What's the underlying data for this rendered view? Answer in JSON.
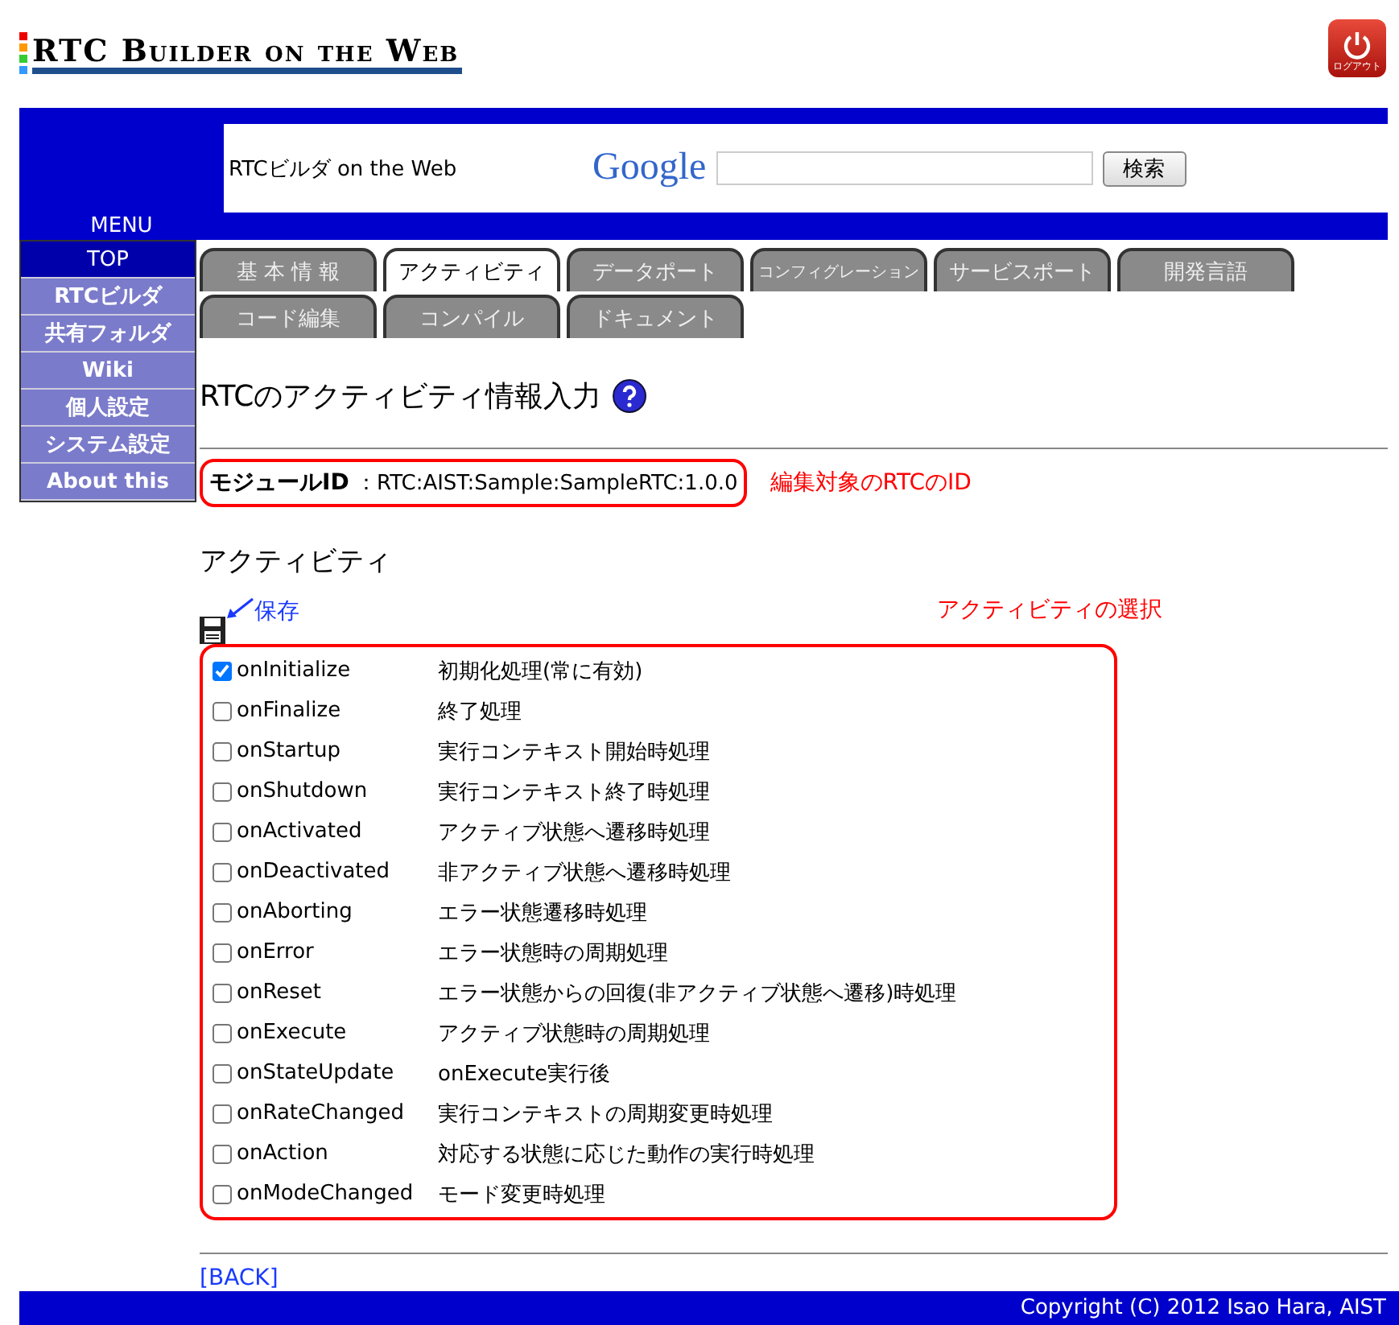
{
  "header": {
    "logo": "RTC Builder on the Web",
    "logout": "ログアウト"
  },
  "banner": {
    "site_name": "RTCビルダ on the Web",
    "search_logo": "Google",
    "search_button": "検索"
  },
  "menu": {
    "title": "MENU",
    "items": [
      {
        "label": "TOP",
        "selected": true
      },
      {
        "label": "RTCビルダ",
        "selected": false
      },
      {
        "label": "共有フォルダ",
        "selected": false
      },
      {
        "label": "Wiki",
        "selected": false
      },
      {
        "label": "個人設定",
        "selected": false
      },
      {
        "label": "システム設定",
        "selected": false
      },
      {
        "label": "About this",
        "selected": false
      }
    ]
  },
  "tabs": [
    [
      {
        "label": "基 本 情 報",
        "selected": false,
        "small": false
      },
      {
        "label": "アクティビティ",
        "selected": true,
        "small": false
      },
      {
        "label": "データポート",
        "selected": false,
        "small": false
      },
      {
        "label": "コンフィグレーション",
        "selected": false,
        "small": true
      },
      {
        "label": "サービスポート",
        "selected": false,
        "small": false
      },
      {
        "label": "開発言語",
        "selected": false,
        "small": false
      }
    ],
    [
      {
        "label": "コード編集",
        "selected": false,
        "small": false
      },
      {
        "label": "コンパイル",
        "selected": false,
        "small": false
      },
      {
        "label": "ドキュメント",
        "selected": false,
        "small": false
      }
    ]
  ],
  "page_title": "RTCのアクティビティ情報入力",
  "module": {
    "label": "モジュールID",
    "value": "：RTC:AIST:Sample:SampleRTC:1.0.0",
    "note": "編集対象のRTCのID"
  },
  "activity_heading": "アクティビティ",
  "save_note": "保存",
  "selection_note": "アクティビティの選択",
  "activities": [
    {
      "name": "onInitialize",
      "description": "初期化処理(常に有効)",
      "checked": true
    },
    {
      "name": "onFinalize",
      "description": "終了処理",
      "checked": false
    },
    {
      "name": "onStartup",
      "description": "実行コンテキスト開始時処理",
      "checked": false
    },
    {
      "name": "onShutdown",
      "description": "実行コンテキスト終了時処理",
      "checked": false
    },
    {
      "name": "onActivated",
      "description": "アクティブ状態へ遷移時処理",
      "checked": false
    },
    {
      "name": "onDeactivated",
      "description": "非アクティブ状態へ遷移時処理",
      "checked": false
    },
    {
      "name": "onAborting",
      "description": "エラー状態遷移時処理",
      "checked": false
    },
    {
      "name": "onError",
      "description": "エラー状態時の周期処理",
      "checked": false
    },
    {
      "name": "onReset",
      "description": "エラー状態からの回復(非アクティブ状態へ遷移)時処理",
      "checked": false
    },
    {
      "name": "onExecute",
      "description": "アクティブ状態時の周期処理",
      "checked": false
    },
    {
      "name": "onStateUpdate",
      "description": "onExecute実行後",
      "checked": false
    },
    {
      "name": "onRateChanged",
      "description": "実行コンテキストの周期変更時処理",
      "checked": false
    },
    {
      "name": "onAction",
      "description": "対応する状態に応じた動作の実行時処理",
      "checked": false
    },
    {
      "name": "onModeChanged",
      "description": "モード変更時処理",
      "checked": false
    }
  ],
  "back_link": "[BACK]",
  "footer": "Copyright (C) 2012 Isao Hara, AIST"
}
